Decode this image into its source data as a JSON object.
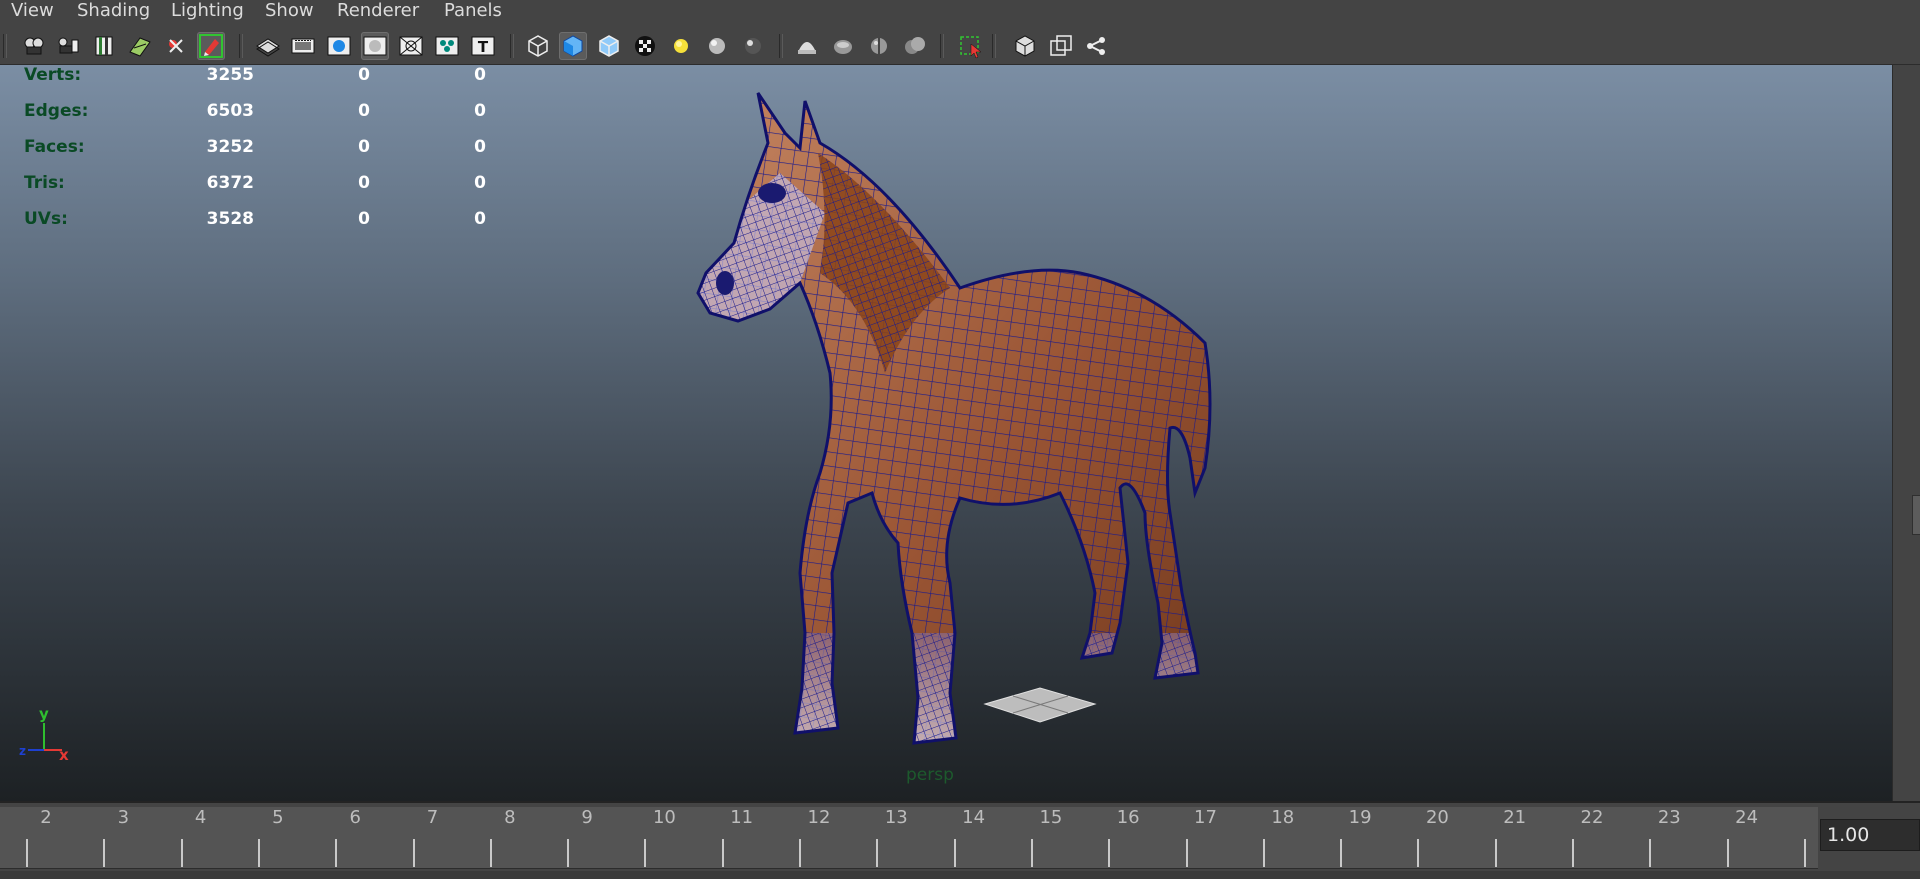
{
  "menubar": {
    "items": [
      {
        "label": "View"
      },
      {
        "label": "Shading"
      },
      {
        "label": "Lighting"
      },
      {
        "label": "Show"
      },
      {
        "label": "Renderer"
      },
      {
        "label": "Panels"
      }
    ]
  },
  "toolbar": {
    "buttons": [
      {
        "icon": "select-camera-icon",
        "active": false
      },
      {
        "icon": "camera-attributes-icon",
        "active": false
      },
      {
        "icon": "bookmarks-icon",
        "active": false
      },
      {
        "icon": "image-plane-icon",
        "active": false
      },
      {
        "icon": "grease-pencil-icon",
        "active": false
      },
      {
        "icon": "camera-tool-icon",
        "active": true
      },
      {
        "icon": "grid-icon",
        "active": false
      },
      {
        "icon": "film-gate-icon",
        "active": false
      },
      {
        "icon": "resolution-gate-icon",
        "active": false
      },
      {
        "icon": "gate-mask-icon",
        "active": true
      },
      {
        "icon": "field-chart-icon",
        "active": false
      },
      {
        "icon": "safe-action-icon",
        "active": false
      },
      {
        "icon": "safe-title-icon",
        "active": false
      },
      {
        "icon": "wireframe-icon",
        "active": false
      },
      {
        "icon": "smooth-shade-icon",
        "active": true
      },
      {
        "icon": "wireframe-on-shaded-icon",
        "active": false
      },
      {
        "icon": "textured-icon",
        "active": false
      },
      {
        "icon": "use-all-lights-icon",
        "active": false
      },
      {
        "icon": "shadows-icon",
        "active": false
      },
      {
        "icon": "high-quality-icon",
        "active": false
      },
      {
        "icon": "xray-icon",
        "active": false
      },
      {
        "icon": "ambient-occlusion-icon",
        "active": false
      },
      {
        "icon": "motion-blur-icon",
        "active": false
      },
      {
        "icon": "anti-alias-icon",
        "active": false
      },
      {
        "icon": "isolate-select-icon",
        "active": false
      },
      {
        "icon": "depth-of-field-icon",
        "active": false
      },
      {
        "icon": "xray-joints-icon",
        "active": false
      },
      {
        "icon": "xray-components-icon",
        "active": false
      }
    ]
  },
  "hud": {
    "rows": [
      {
        "label": "Verts:",
        "values": [
          "3255",
          "0",
          "0"
        ]
      },
      {
        "label": "Edges:",
        "values": [
          "6503",
          "0",
          "0"
        ]
      },
      {
        "label": "Faces:",
        "values": [
          "3252",
          "0",
          "0"
        ]
      },
      {
        "label": "Tris:",
        "values": [
          "6372",
          "0",
          "0"
        ]
      },
      {
        "label": "UVs:",
        "values": [
          "3528",
          "0",
          "0"
        ]
      }
    ]
  },
  "axis": {
    "y": "y",
    "x": "x",
    "z": "z"
  },
  "viewport": {
    "camera": "persp"
  },
  "timeline": {
    "frames": [
      "2",
      "3",
      "4",
      "5",
      "6",
      "7",
      "8",
      "9",
      "10",
      "11",
      "12",
      "13",
      "14",
      "15",
      "16",
      "17",
      "18",
      "19",
      "20",
      "21",
      "22",
      "23",
      "24"
    ],
    "current_value": "1.00"
  },
  "colors": {
    "hud_label": "#0a4a25",
    "hud_value": "#ffffff",
    "wire": "#1a1a8c",
    "model_fill": "#8a4a2a"
  }
}
